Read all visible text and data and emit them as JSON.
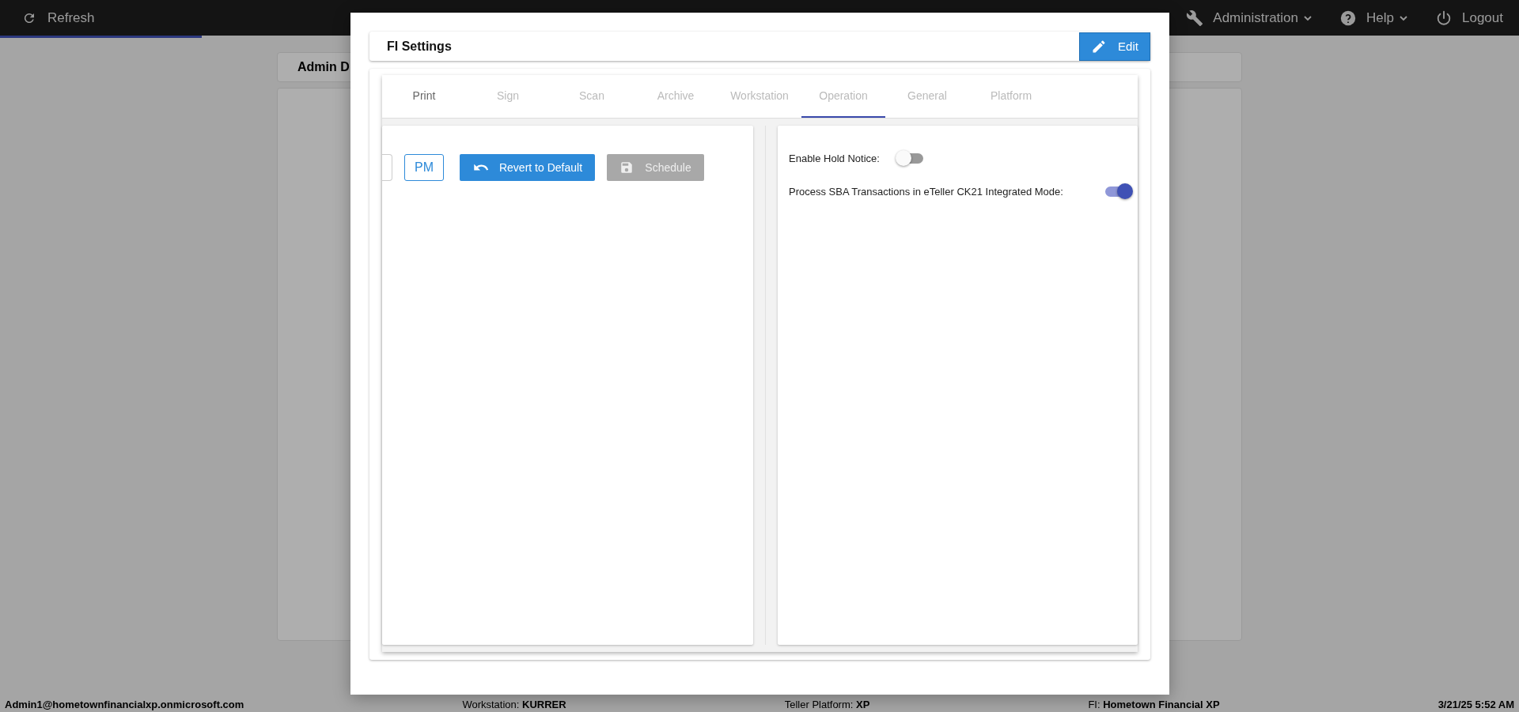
{
  "top_bar": {
    "refresh": "Refresh",
    "menus": [
      {
        "label": "Administration",
        "kind": "dropdown"
      },
      {
        "label": "Help",
        "kind": "dropdown"
      },
      {
        "label": "Logout",
        "kind": "action"
      }
    ]
  },
  "background": {
    "card_title": "Admin D"
  },
  "modal": {
    "title": "FI Settings",
    "edit_button": "Edit",
    "tabs": [
      {
        "label": "Print",
        "selected": false,
        "disabled": false
      },
      {
        "label": "Sign",
        "selected": false,
        "disabled": true
      },
      {
        "label": "Scan",
        "selected": false,
        "disabled": true
      },
      {
        "label": "Archive",
        "selected": false,
        "disabled": true
      },
      {
        "label": "Workstation",
        "selected": false,
        "disabled": true
      },
      {
        "label": "Operation",
        "selected": true,
        "disabled": true
      },
      {
        "label": "General",
        "selected": false,
        "disabled": true
      },
      {
        "label": "Platform",
        "selected": false,
        "disabled": true
      }
    ],
    "left_panel": {
      "pm_button": "PM",
      "revert_button": "Revert to Default",
      "schedule_button": {
        "label": "Schedule",
        "disabled": true
      }
    },
    "settings": [
      {
        "label": "Enable Hold Notice:",
        "on": false
      },
      {
        "label": "Process SBA Transactions in eTeller CK21 Integrated Mode:",
        "on": true
      }
    ]
  },
  "status_bar": {
    "user": "Admin1@hometownfinancialxp.onmicrosoft.com",
    "items": [
      {
        "label": "Workstation:",
        "value": "KURRER"
      },
      {
        "label": "Teller Platform:",
        "value": "XP"
      },
      {
        "label": "FI:",
        "value": "Hometown Financial XP"
      }
    ],
    "datetime": "3/21/25 5:52 AM"
  }
}
